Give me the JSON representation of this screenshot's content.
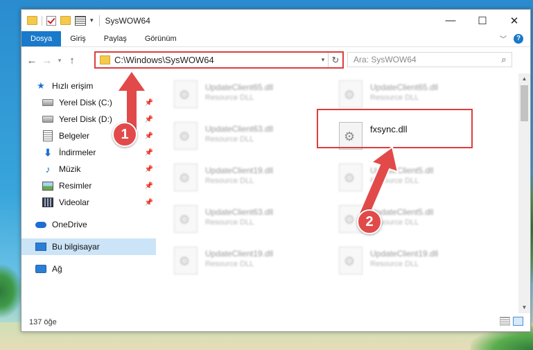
{
  "window": {
    "title": "SysWOW64",
    "controls": {
      "minimize": "—",
      "maximize": "☐",
      "close": "✕"
    }
  },
  "ribbon": {
    "tabs": [
      {
        "label": "Dosya",
        "active": true
      },
      {
        "label": "Giriş"
      },
      {
        "label": "Paylaş"
      },
      {
        "label": "Görünüm"
      }
    ],
    "help": "?"
  },
  "navbar": {
    "address": "C:\\Windows\\SysWOW64",
    "search_placeholder": "Ara: SysWOW64"
  },
  "sidebar": {
    "items": [
      {
        "label": "Hızlı erişim",
        "icon": "star-icon"
      },
      {
        "label": "Yerel Disk (C:)",
        "icon": "drive-icon",
        "pinned": true
      },
      {
        "label": "Yerel Disk (D:)",
        "icon": "drive-icon",
        "pinned": true
      },
      {
        "label": "Belgeler",
        "icon": "documents-icon",
        "pinned": true
      },
      {
        "label": "İndirmeler",
        "icon": "download-icon",
        "pinned": true
      },
      {
        "label": "Müzik",
        "icon": "music-icon",
        "pinned": true
      },
      {
        "label": "Resimler",
        "icon": "pictures-icon",
        "pinned": true
      },
      {
        "label": "Videolar",
        "icon": "videos-icon",
        "pinned": true
      },
      {
        "label": "OneDrive",
        "icon": "cloud-icon"
      },
      {
        "label": "Bu bilgisayar",
        "icon": "computer-icon",
        "selected": true
      },
      {
        "label": "Ağ",
        "icon": "network-icon"
      }
    ]
  },
  "files": [
    {
      "name": "UpdateClient65.dll",
      "type": "Resource DLL",
      "blurred": true
    },
    {
      "name": "UpdateClient65.dll",
      "type": "Resource DLL",
      "blurred": true
    },
    {
      "name": "UpdateClient63.dll",
      "type": "Resource DLL",
      "blurred": true
    },
    {
      "name": "fxsync.dll",
      "type": "",
      "blurred": false,
      "highlighted": true
    },
    {
      "name": "UpdateClient19.dll",
      "type": "Resource DLL",
      "blurred": true
    },
    {
      "name": "UpdateClient5.dll",
      "type": "Resource DLL",
      "blurred": true
    },
    {
      "name": "UpdateClient63.dll",
      "type": "Resource DLL",
      "blurred": true
    },
    {
      "name": "UpdateClient5.dll",
      "type": "Resource DLL",
      "blurred": true
    },
    {
      "name": "UpdateClient19.dll",
      "type": "Resource DLL",
      "blurred": true
    },
    {
      "name": "UpdateClient19.dll",
      "type": "Resource DLL",
      "blurred": true
    }
  ],
  "status": {
    "count": "137 öğe"
  },
  "annotations": {
    "step1": "1",
    "step2": "2"
  },
  "colors": {
    "accent": "#1979ca",
    "highlight": "#dd3c3c",
    "selected_bg": "#cce4f7"
  }
}
